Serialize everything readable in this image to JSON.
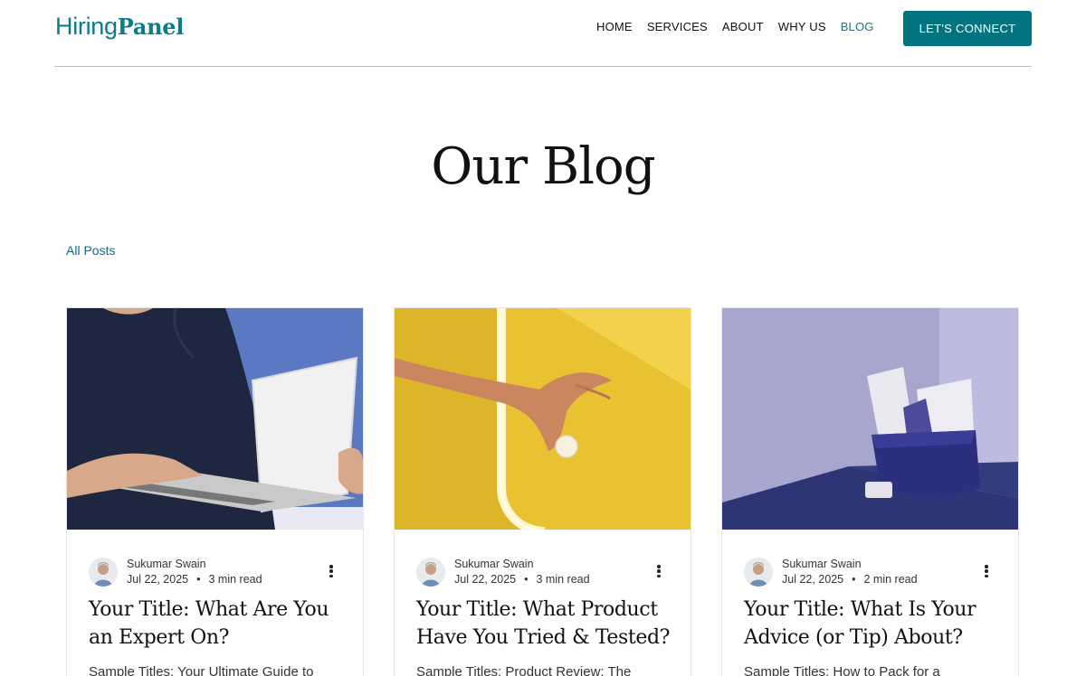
{
  "header": {
    "logo_light": "Hiring",
    "logo_bold": "Panel",
    "nav": [
      {
        "label": "HOME"
      },
      {
        "label": "SERVICES"
      },
      {
        "label": "ABOUT"
      },
      {
        "label": "WHY US"
      },
      {
        "label": "BLOG"
      }
    ],
    "active_nav": "BLOG",
    "cta_label": "LET'S CONNECT"
  },
  "page": {
    "title": "Our Blog",
    "filter_label": "All Posts"
  },
  "posts": [
    {
      "author": "Sukumar Swain",
      "date": "Jul 22, 2025",
      "read_time": "3 min read",
      "title": "Your Title: What Are You an Expert On?",
      "excerpt": "Sample Titles: Your Ultimate Guide to",
      "image_icon": "laptop-photo"
    },
    {
      "author": "Sukumar Swain",
      "date": "Jul 22, 2025",
      "read_time": "3 min read",
      "title": "Your Title: What Product Have You Tried & Tested?",
      "excerpt": "Sample Titles: Product Review: The",
      "image_icon": "yellow-hand-photo"
    },
    {
      "author": "Sukumar Swain",
      "date": "Jul 22, 2025",
      "read_time": "2 min read",
      "title": "Your Title: What Is Your Advice (or Tip) About?",
      "excerpt": "Sample Titles: How to Pack for a",
      "image_icon": "desk-organizer-photo"
    }
  ],
  "dot_separator": "•",
  "colors": {
    "brand": "#0a7d8c",
    "cta_bg": "#03747f"
  }
}
